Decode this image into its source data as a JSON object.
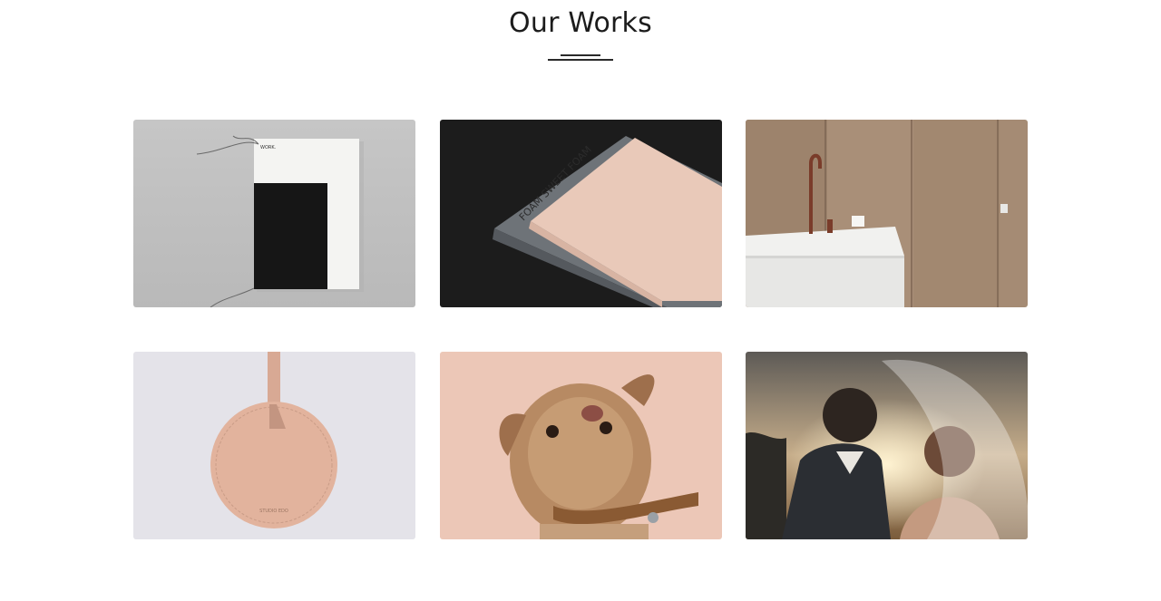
{
  "section": {
    "title": "Our Works"
  },
  "works": [
    {
      "print_text": "WORK."
    },
    {
      "print_text": "FOAM SWEET FOAM"
    },
    {},
    {
      "print_text": "STUDIO EDO"
    },
    {},
    {}
  ]
}
